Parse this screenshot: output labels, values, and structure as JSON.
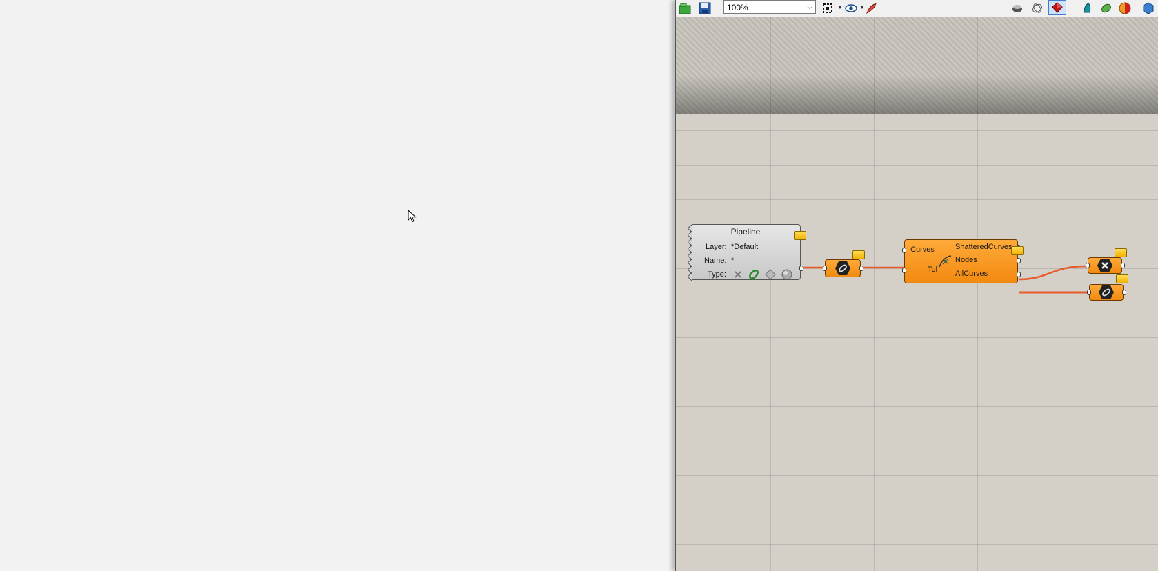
{
  "toolbar": {
    "zoom_value": "100%",
    "icons": [
      "open-file-icon",
      "save-icon",
      "zoom-extents-icon",
      "preview-eye-icon",
      "sketch-icon",
      "preview-off-icon",
      "preview-wire-icon",
      "preview-shaded-icon",
      "bake-icon",
      "selected-only-icon",
      "material-icon",
      "document-icon"
    ]
  },
  "nodes": {
    "pipeline": {
      "title": "Pipeline",
      "layer_label": "Layer:",
      "layer_value": "*Default",
      "name_label": "Name:",
      "name_value": "*",
      "type_label": "Type:"
    },
    "shatter": {
      "input_curves": "Curves",
      "input_tol": "Tol",
      "output_shattered": "ShatteredCurves",
      "output_nodes": "Nodes",
      "output_allcurves": "AllCurves"
    }
  },
  "colors": {
    "canvas": "#d4d0c8",
    "component": "#f59a20",
    "wire": "#e85a2a",
    "balloon": "#f5c518"
  }
}
